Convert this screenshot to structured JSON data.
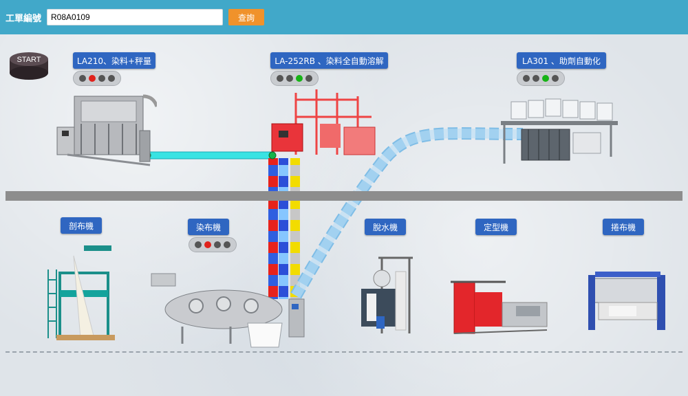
{
  "header": {
    "work_order_label": "工單編號",
    "work_order_value": "R08A0109",
    "query_label": "查詢"
  },
  "start": {
    "label": "START"
  },
  "top_stations": [
    {
      "label": "LA210、染料+秤量",
      "lights": [
        "off",
        "red",
        "off",
        "off"
      ]
    },
    {
      "label": "LA-252RB 、染料全自動溶解",
      "lights": [
        "off",
        "off",
        "green",
        "off"
      ]
    },
    {
      "label": "LA301 、助劑自動化",
      "lights": [
        "off",
        "off",
        "green",
        "off"
      ]
    }
  ],
  "bottom_stations": [
    {
      "label": "剖布機"
    },
    {
      "label": "染布機",
      "lights": [
        "off",
        "red",
        "off",
        "off"
      ]
    },
    {
      "label": "脫水機"
    },
    {
      "label": "定型機"
    },
    {
      "label": "捲布機"
    }
  ],
  "colors": {
    "header": "#41a8c9",
    "query_button": "#f0922b",
    "tag": "#2f66c1",
    "red_light": "#e0221c",
    "green_light": "#16b316",
    "pipe_cyan": "#39e3e3",
    "pipe_light_blue": "#a9d4f2"
  },
  "icons": [
    "start-disc-icon",
    "gear-icon"
  ]
}
